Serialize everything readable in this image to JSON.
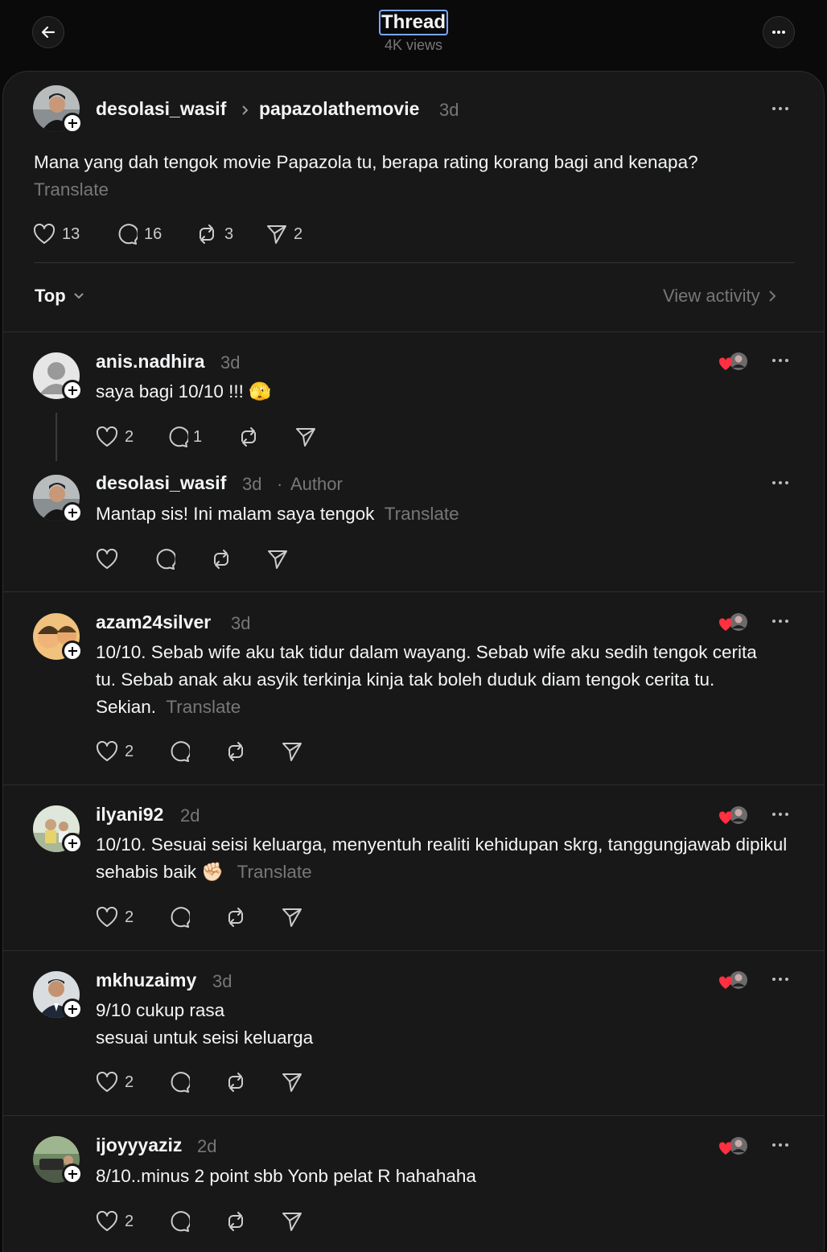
{
  "header": {
    "title": "Thread",
    "views": "4K views"
  },
  "op": {
    "username": "desolasi_wasif",
    "reply_to": "papazolathemovie",
    "time": "3d",
    "text": "Mana yang dah tengok movie Papazola tu, berapa rating korang bagi and kenapa?",
    "translate": "Translate",
    "likes": "13",
    "comments": "16",
    "reposts": "3",
    "shares": "2"
  },
  "sort": {
    "label": "Top",
    "view_activity": "View activity"
  },
  "replies": [
    {
      "username": "anis.nadhira",
      "time": "3d",
      "text": "saya bagi 10/10 !!!",
      "emoji": "🫣",
      "likes": "2",
      "comments": "1"
    },
    {
      "username": "desolasi_wasif",
      "time": "3d",
      "author_tag": "Author",
      "text": "Mantap sis! Ini malam saya tengok",
      "translate": "Translate"
    },
    {
      "username": "azam24silver",
      "time": "3d",
      "text": "10/10. Sebab wife aku tak tidur dalam wayang. Sebab wife aku sedih tengok cerita tu. Sebab anak aku asyik terkinja kinja tak boleh duduk diam tengok cerita tu. Sekian.",
      "translate": "Translate",
      "likes": "2"
    },
    {
      "username": "ilyani92",
      "time": "2d",
      "text": "10/10. Sesuai seisi keluarga, menyentuh realiti kehidupan skrg, tanggungjawab dipikul sehabis baik",
      "emoji": "✊🏻",
      "translate": "Translate",
      "likes": "2"
    },
    {
      "username": "mkhuzaimy",
      "time": "3d",
      "text_line1": "9/10 cukup rasa",
      "text_line2": "sesuai untuk seisi keluarga",
      "likes": "2"
    },
    {
      "username": "ijoyyyaziz",
      "time": "2d",
      "text": "8/10..minus 2 point sbb Yonb pelat R hahahaha",
      "likes": "2"
    }
  ],
  "icons": [
    "back-arrow-icon",
    "more-icon",
    "heart-icon",
    "comment-icon",
    "repost-icon",
    "share-icon",
    "chevron-down-icon",
    "chevron-right-icon"
  ],
  "colors": {
    "background": "#0a0a0a",
    "card": "#181818",
    "muted": "#777777",
    "text": "#f3f5f7",
    "like_red": "#ff3040"
  }
}
